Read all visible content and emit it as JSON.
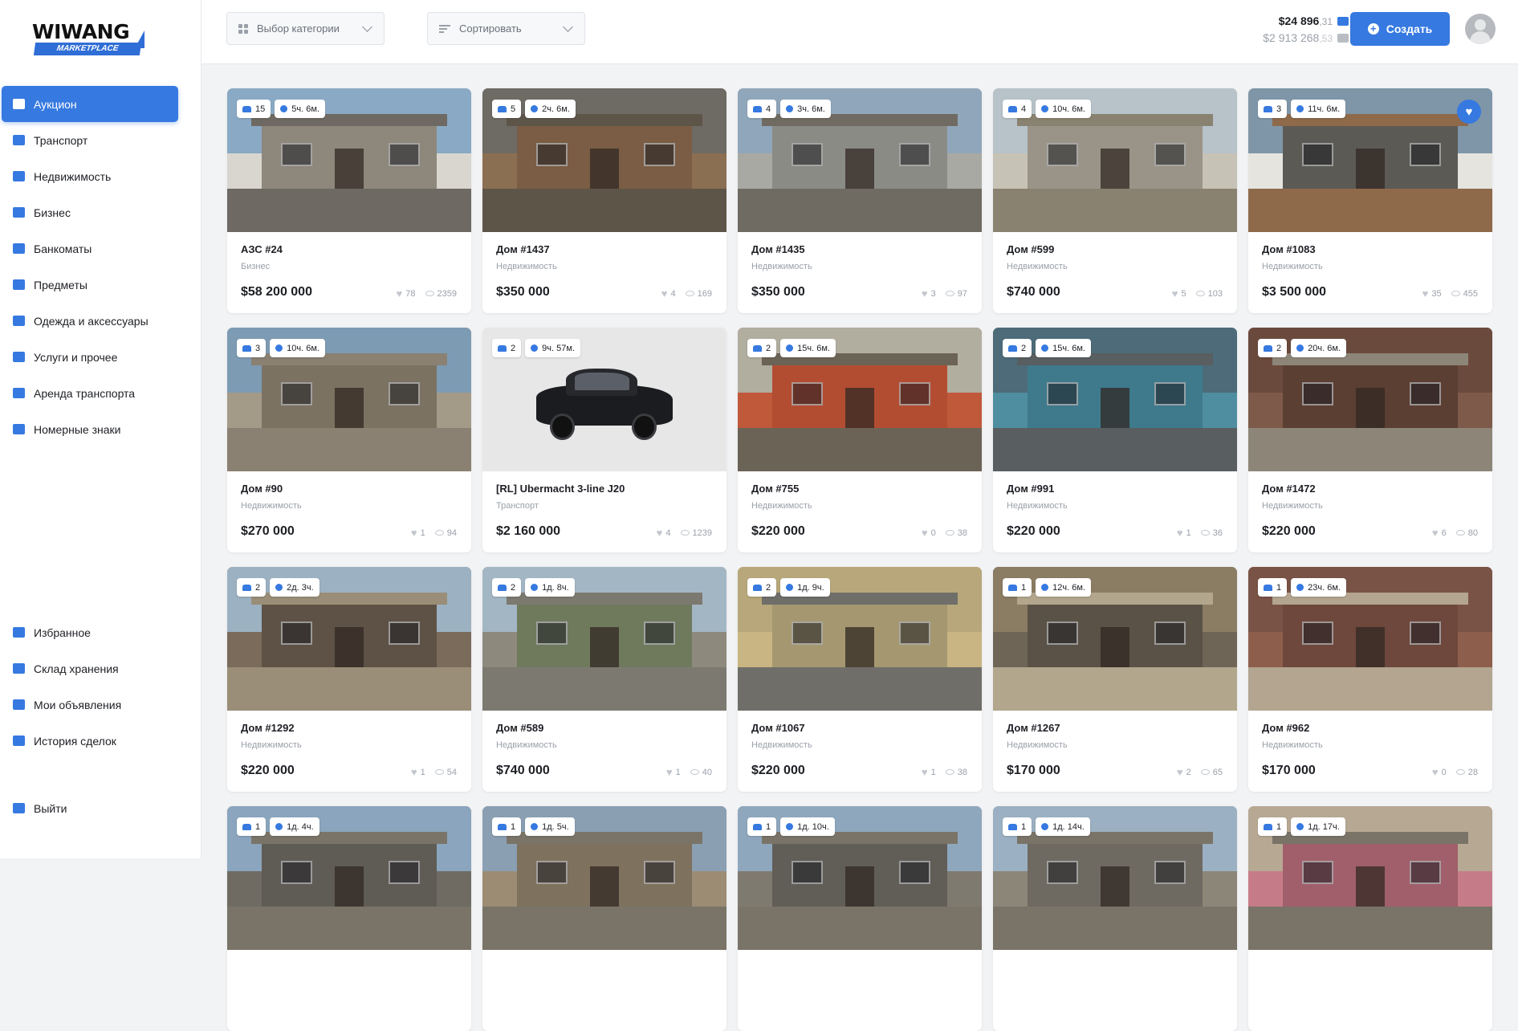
{
  "logo": {
    "main": "WIWANG",
    "sub": "MARKETPLACE"
  },
  "sidebar": {
    "items": [
      {
        "label": "Аукцион",
        "icon": "gavel-icon",
        "active": true
      },
      {
        "label": "Транспорт",
        "icon": "car-icon"
      },
      {
        "label": "Недвижимость",
        "icon": "house-icon"
      },
      {
        "label": "Бизнес",
        "icon": "briefcase-icon"
      },
      {
        "label": "Банкоматы",
        "icon": "atm-icon"
      },
      {
        "label": "Предметы",
        "icon": "box-icon"
      },
      {
        "label": "Одежда и аксессуары",
        "icon": "shirt-icon"
      },
      {
        "label": "Услуги и прочее",
        "icon": "handshake-icon"
      },
      {
        "label": "Аренда транспорта",
        "icon": "rent-icon"
      },
      {
        "label": "Номерные знаки",
        "icon": "plate-icon"
      }
    ],
    "bottom_items": [
      {
        "label": "Избранное",
        "icon": "heart-icon"
      },
      {
        "label": "Склад хранения",
        "icon": "warehouse-icon"
      },
      {
        "label": "Мои объявления",
        "icon": "listing-icon"
      },
      {
        "label": "История сделок",
        "icon": "history-icon"
      }
    ],
    "logout": {
      "label": "Выйти",
      "icon": "logout-icon"
    }
  },
  "topbar": {
    "category_placeholder": "Выбор категории",
    "sort_placeholder": "Сортировать",
    "balance_main": "$24 896",
    "balance_main_cents": ",31",
    "balance_bank": "$2 913 268",
    "balance_bank_cents": ",53",
    "create_label": "Создать"
  },
  "colors": {
    "accent": "#3679e0",
    "text": "#1d1f24",
    "muted": "#9aa0a9"
  },
  "cards": [
    {
      "bidders": "15",
      "time": "5ч. 6м.",
      "title": "АЗС #24",
      "category": "Бизнес",
      "price": "$58 200 000",
      "likes": "78",
      "views": "2359",
      "scene": [
        "#8aa9c4",
        "#d9d6cf",
        "#8d877c",
        "#6e6a63"
      ],
      "fav": false
    },
    {
      "bidders": "5",
      "time": "2ч. 6м.",
      "title": "Дом #1437",
      "category": "Недвижимость",
      "price": "$350 000",
      "likes": "4",
      "views": "169",
      "scene": [
        "#6e6a64",
        "#8b6f52",
        "#7a5d44",
        "#5e5549"
      ],
      "fav": false
    },
    {
      "bidders": "4",
      "time": "3ч. 6м.",
      "title": "Дом #1435",
      "category": "Недвижимость",
      "price": "$350 000",
      "likes": "3",
      "views": "97",
      "scene": [
        "#90a6ba",
        "#a9a9a4",
        "#8b8b86",
        "#6f6b62"
      ],
      "fav": false
    },
    {
      "bidders": "4",
      "time": "10ч. 6м.",
      "title": "Дом #599",
      "category": "Недвижимость",
      "price": "$740 000",
      "likes": "5",
      "views": "103",
      "scene": [
        "#b7c2c9",
        "#c7c2b6",
        "#9a9488",
        "#8a8270"
      ],
      "fav": false
    },
    {
      "bidders": "3",
      "time": "11ч. 6м.",
      "title": "Дом #1083",
      "category": "Недвижимость",
      "price": "$3 500 000",
      "likes": "35",
      "views": "455",
      "scene": [
        "#7f96a8",
        "#e6e4df",
        "#5c5a55",
        "#8e6a4b"
      ],
      "fav": true
    },
    {
      "bidders": "3",
      "time": "10ч. 6м.",
      "title": "Дом #90",
      "category": "Недвижимость",
      "price": "$270 000",
      "likes": "1",
      "views": "94",
      "scene": [
        "#7d9bb3",
        "#a49a88",
        "#7b7262",
        "#8a8172"
      ],
      "fav": false
    },
    {
      "bidders": "2",
      "time": "9ч. 57м.",
      "title": "[RL] Ubermacht 3-line J20",
      "category": "Транспорт",
      "price": "$2 160 000",
      "likes": "4",
      "views": "1239",
      "scene": [
        "#e7e7e7",
        "#e7e7e7",
        "#e7e7e7",
        "#d8d8d8"
      ],
      "fav": false,
      "car": true
    },
    {
      "bidders": "2",
      "time": "15ч. 6м.",
      "title": "Дом #755",
      "category": "Недвижимость",
      "price": "$220 000",
      "likes": "0",
      "views": "38",
      "scene": [
        "#b1ad9f",
        "#c0583a",
        "#b34d32",
        "#6c6357"
      ],
      "fav": false
    },
    {
      "bidders": "2",
      "time": "15ч. 6м.",
      "title": "Дом #991",
      "category": "Недвижимость",
      "price": "$220 000",
      "likes": "1",
      "views": "36",
      "scene": [
        "#4d6b78",
        "#4f8ea0",
        "#3e7a8c",
        "#595e60"
      ],
      "fav": false
    },
    {
      "bidders": "2",
      "time": "20ч. 6м.",
      "title": "Дом #1472",
      "category": "Недвижимость",
      "price": "$220 000",
      "likes": "6",
      "views": "80",
      "scene": [
        "#6b4a3e",
        "#7d5a49",
        "#5b3f33",
        "#8d8678"
      ],
      "fav": false
    },
    {
      "bidders": "2",
      "time": "2д. 3ч.",
      "title": "Дом #1292",
      "category": "Недвижимость",
      "price": "$220 000",
      "likes": "1",
      "views": "54",
      "scene": [
        "#9cb1c2",
        "#7a6b5a",
        "#5e5246",
        "#9a8e78"
      ],
      "fav": false
    },
    {
      "bidders": "2",
      "time": "1д. 8ч.",
      "title": "Дом #589",
      "category": "Недвижимость",
      "price": "$740 000",
      "likes": "1",
      "views": "40",
      "scene": [
        "#a3b6c4",
        "#8d8a7d",
        "#6f7a5d",
        "#7c7a70"
      ],
      "fav": false
    },
    {
      "bidders": "2",
      "time": "1д. 9ч.",
      "title": "Дом #1067",
      "category": "Недвижимость",
      "price": "$220 000",
      "likes": "1",
      "views": "38",
      "scene": [
        "#b7a77a",
        "#c9b583",
        "#a59870",
        "#6f6e69"
      ],
      "fav": false
    },
    {
      "bidders": "1",
      "time": "12ч. 6м.",
      "title": "Дом #1267",
      "category": "Недвижимость",
      "price": "$170 000",
      "likes": "2",
      "views": "65",
      "scene": [
        "#8b7c64",
        "#6e6556",
        "#5a5246",
        "#b2a68d"
      ],
      "fav": false
    },
    {
      "bidders": "1",
      "time": "23ч. 6м.",
      "title": "Дом #962",
      "category": "Недвижимость",
      "price": "$170 000",
      "likes": "0",
      "views": "28",
      "scene": [
        "#7a5347",
        "#8e5e4c",
        "#6e483c",
        "#b3a58f"
      ],
      "fav": false
    },
    {
      "bidders": "1",
      "time": "1д. 4ч.",
      "title": "",
      "category": "",
      "price": "",
      "likes": "",
      "views": "",
      "scene": [
        "#8aa5bd",
        "#6f6b63",
        "#5f5b55",
        "#7a7468"
      ],
      "fav": false
    },
    {
      "bidders": "1",
      "time": "1д. 5ч.",
      "title": "",
      "category": "",
      "price": "",
      "likes": "",
      "views": "",
      "scene": [
        "#8a9fb2",
        "#9c8c74",
        "#7e715e",
        "#7a7468"
      ],
      "fav": false
    },
    {
      "bidders": "1",
      "time": "1д. 10ч.",
      "title": "",
      "category": "",
      "price": "",
      "likes": "",
      "views": "",
      "scene": [
        "#8ea7bd",
        "#7f7a70",
        "#615d57",
        "#7a7468"
      ],
      "fav": false
    },
    {
      "bidders": "1",
      "time": "1д. 14ч.",
      "title": "",
      "category": "",
      "price": "",
      "likes": "",
      "views": "",
      "scene": [
        "#9bb0c2",
        "#8c8678",
        "#6e6a62",
        "#7a7468"
      ],
      "fav": false
    },
    {
      "bidders": "1",
      "time": "1д. 17ч.",
      "title": "",
      "category": "",
      "price": "",
      "likes": "",
      "views": "",
      "scene": [
        "#b7a894",
        "#c67c88",
        "#a05f6a",
        "#7a7468"
      ],
      "fav": false
    }
  ]
}
